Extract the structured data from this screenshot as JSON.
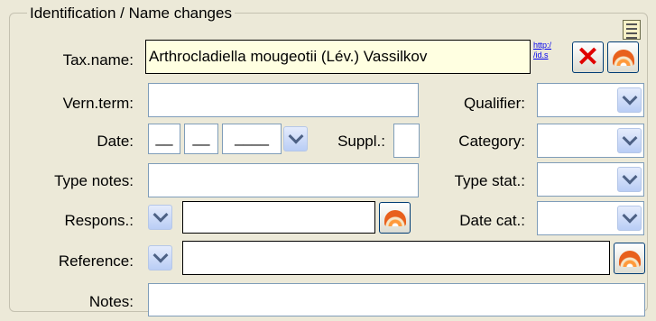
{
  "group": {
    "title": "Identification / Name changes"
  },
  "labels": {
    "tax_name": "Tax.name:",
    "vern_term": "Vern.term:",
    "date": "Date:",
    "suppl": "Suppl.:",
    "type_notes": "Type notes:",
    "respons": "Respons.:",
    "reference": "Reference:",
    "notes": "Notes:",
    "qualifier": "Qualifier:",
    "category": "Category:",
    "type_stat": "Type stat.:",
    "date_cat": "Date cat.:"
  },
  "fields": {
    "tax_name": "Arthrocladiella mougeotii (Lév.) Vassilkov",
    "vern_term": "",
    "type_notes": "",
    "respons": "",
    "reference": "",
    "notes": "",
    "suppl": "",
    "date_day": "__",
    "date_month": "__",
    "date_year": "____",
    "qualifier": "",
    "category": "",
    "type_stat": "",
    "date_cat": ""
  },
  "link": {
    "line1": "http:/",
    "line2": "/id.s"
  },
  "icons": {
    "remove": "red-x-icon",
    "lookup": "shell-icon",
    "chevron": "chevron-down-icon",
    "list": "list-icon"
  }
}
